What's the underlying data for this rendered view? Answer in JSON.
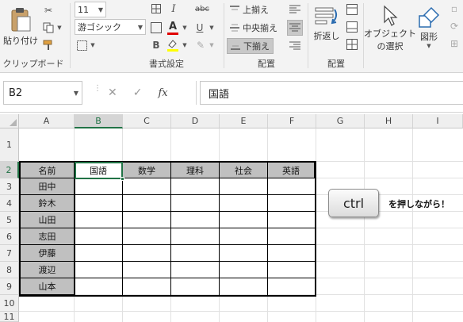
{
  "ribbon": {
    "clipboard": {
      "paste_label": "貼り付け",
      "group_label": "クリップボード"
    },
    "font": {
      "font_size": "11",
      "font_name": "游ゴシック",
      "italic": "I",
      "bold": "B",
      "strike": "abc",
      "font_color": "A",
      "underline": "U",
      "group_label": "書式設定"
    },
    "alignment": {
      "top_align": "上揃え",
      "middle_align": "中央揃え",
      "bottom_align": "下揃え",
      "group_label": "配置"
    },
    "arrange": {
      "wrap_label": "折返し",
      "group_label": "配置"
    },
    "objects": {
      "select_objects_line1": "オブジェクト",
      "select_objects_line2": "の選択",
      "shapes_label": "図形"
    }
  },
  "formula_bar": {
    "name_box": "B2",
    "cancel_symbol": "✕",
    "enter_symbol": "✓",
    "fx_symbol": "fx",
    "value": "国語"
  },
  "sheet": {
    "corner": "",
    "columns": [
      "A",
      "B",
      "C",
      "D",
      "E",
      "F",
      "G",
      "H",
      "I"
    ],
    "rows": [
      "1",
      "2",
      "3",
      "4",
      "5",
      "6",
      "7",
      "8",
      "9",
      "10",
      "11"
    ],
    "active_column": "B",
    "active_row": "2",
    "table_header": [
      "名前",
      "国語",
      "数学",
      "理科",
      "社会",
      "英語"
    ],
    "names": [
      "田中",
      "鈴木",
      "山田",
      "志田",
      "伊藤",
      "渡辺",
      "山本"
    ],
    "colors": {
      "header_fill": "#c0c0c0",
      "active_accent": "#217346"
    }
  },
  "overlay": {
    "key_label": "ctrl",
    "caption": "を押しながら！"
  }
}
